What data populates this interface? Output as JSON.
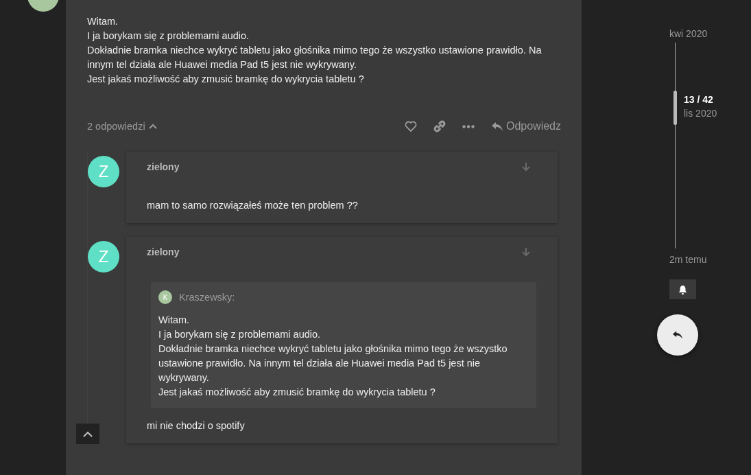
{
  "post": {
    "text": "Witam.\nI ja borykam się z problemami audio.\nDokładnie bramka niechce wykryć tabletu jako głośnika mimo tego że wszystko ustawione prawidło. Na innym tel działa ale Huawei media Pad t5 jest nie wykrywany.\nJest jakaś możliwość aby zmusić bramkę do wykrycia tabletu ?",
    "replies_toggle": "2 odpowiedzi",
    "replies_expanded": true,
    "reply_button": "Odpowiedz"
  },
  "replies": [
    {
      "username": "zielony",
      "avatar_letter": "Z",
      "text": "mam to samo rozwiązałeś może ten problem ??"
    },
    {
      "username": "zielony",
      "avatar_letter": "Z",
      "quote": {
        "avatar_letter": "K",
        "author": "Kraszewsky:",
        "text": "Witam.\nI ja borykam się z problemami audio.\nDokładnie bramka niechce wykryć tabletu jako głośnika mimo tego że wszystko ustawione prawidło. Na innym tel działa ale Huawei media Pad t5 jest nie wykrywany.\nJest jakaś możliwość aby zmusić bramkę do wykrycia tabletu ?"
      },
      "text": "mi nie chodzi o spotify"
    }
  ],
  "timeline": {
    "start": "kwi 2020",
    "position": "13 / 42",
    "position_date": "lis 2020",
    "end": "2m temu"
  }
}
